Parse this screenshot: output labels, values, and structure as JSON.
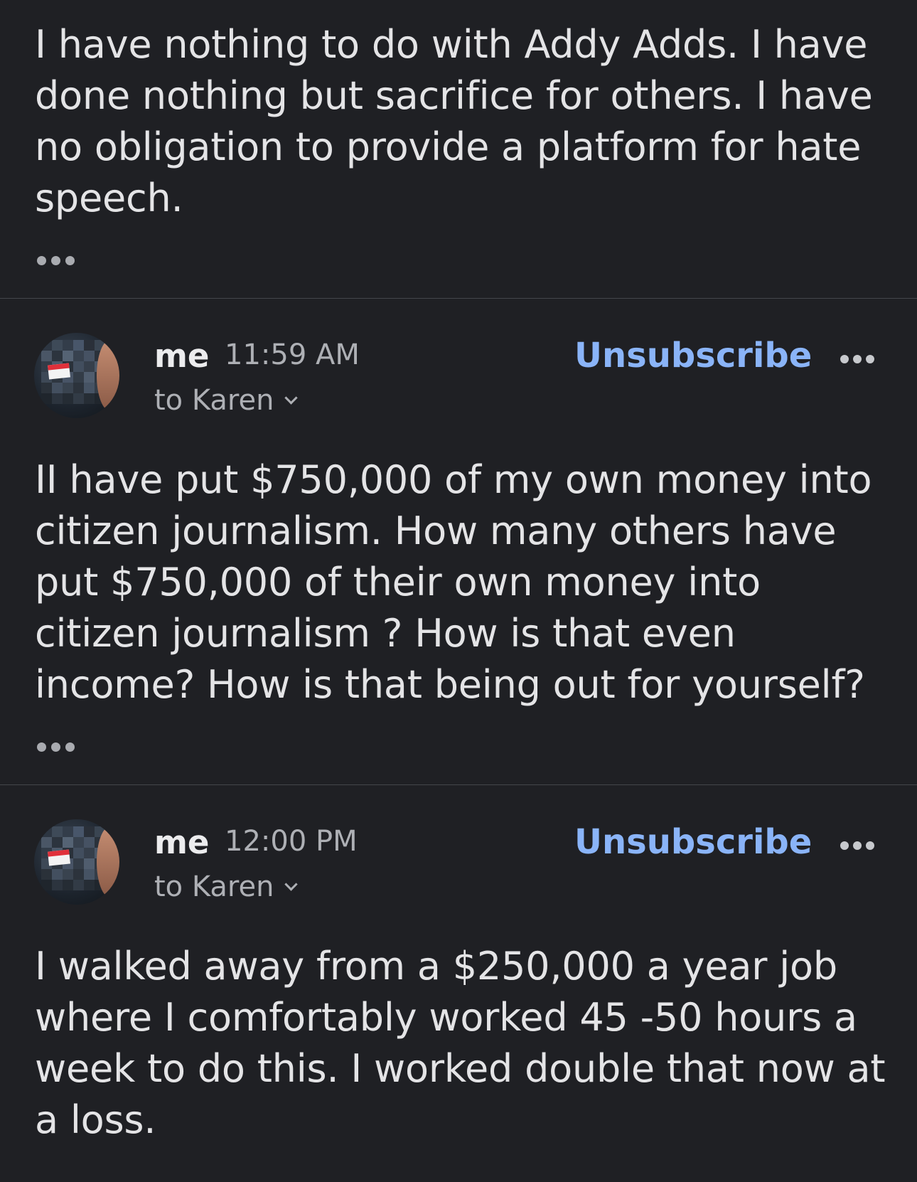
{
  "messages": [
    {
      "body": "I have nothing to do with Addy Adds. I have\ndone nothing but sacrifice for others.  I have\nno obligation to provide a platform for hate\nspeech."
    },
    {
      "sender": "me",
      "time": "11:59 AM",
      "to": "to Karen",
      "unsubscribe": "Unsubscribe",
      "body": "II have put $750,000 of my own money into\ncitizen journalism.  How many others have\nput $750,000 of their own money into\ncitizen journalism ?  How is that even\nincome? How is that being out for yourself?"
    },
    {
      "sender": "me",
      "time": "12:00 PM",
      "to": "to Karen",
      "unsubscribe": "Unsubscribe",
      "body": "I walked away from a $250,000 a year job\nwhere I comfortably worked 45 -50 hours a\nweek to do this. I worked double that now at\na loss."
    }
  ],
  "colors": {
    "background": "#1f2024",
    "text": "#e4e4e6",
    "secondary_text": "#aeb0b5",
    "link": "#8ab4f8"
  },
  "icons": {
    "expand": "ellipsis-icon",
    "more": "more-options-icon",
    "recipients": "chevron-down-icon"
  }
}
